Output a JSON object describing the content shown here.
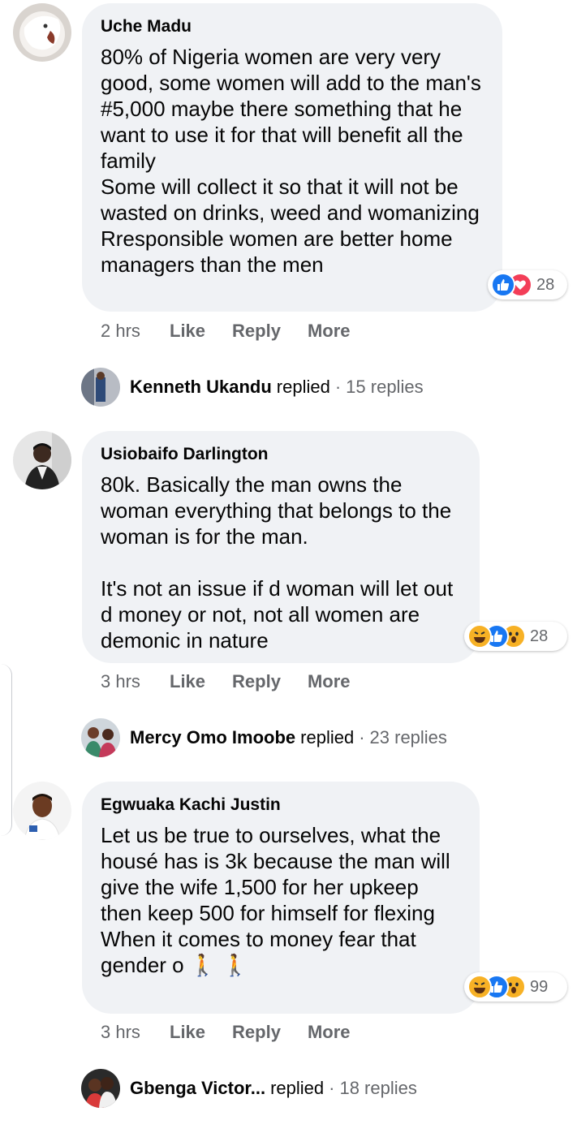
{
  "comments": [
    {
      "author": "Uche Madu",
      "text": "80% of Nigeria women are very very good, some women will add to the man's #5,000 maybe there something that he want to use it for that will benefit all the family\nSome will collect it so that it will not be wasted on drinks, weed and womanizing\nRresponsible women are better home managers than the men",
      "reaction_count": "28",
      "time": "2 hrs",
      "like": "Like",
      "reply": "Reply",
      "more": "More",
      "replier": "Kenneth Ukandu",
      "replied": "replied",
      "replies": "15 replies"
    },
    {
      "author": "Usiobaifo Darlington",
      "text": "80k. Basically the man owns the woman everything that belongs to the woman is for the man.\n\nIt's not an issue if d woman will let out d money or not, not all women are demonic in nature",
      "reaction_count": "28",
      "time": "3 hrs",
      "like": "Like",
      "reply": "Reply",
      "more": "More",
      "replier": "Mercy Omo Imoobe",
      "replied": "replied",
      "replies": "23 replies"
    },
    {
      "author": "Egwuaka Kachi Justin",
      "text": "Let us be true to ourselves, what the housé has is 3k because the man will give the wife 1,500 for her upkeep then keep 500 for himself for flexing\nWhen it comes to money fear that gender o 🚶 🚶",
      "reaction_count": "99",
      "time": "3 hrs",
      "like": "Like",
      "reply": "Reply",
      "more": "More",
      "replier": "Gbenga Victor...",
      "replied": "replied",
      "replies": "18 replies"
    }
  ],
  "reaction_icons": {
    "c0": [
      "like-icon",
      "love-icon"
    ],
    "c1": [
      "haha-icon",
      "like-icon",
      "wow-icon"
    ],
    "c2": [
      "haha-icon",
      "like-icon",
      "wow-icon"
    ]
  },
  "separator": "·",
  "colors": {
    "bubble": "#f0f2f5",
    "like_blue": "#1877f2",
    "love_red": "#f33e58",
    "emoji_yellow": "#f7b125",
    "meta_gray": "#65676b"
  }
}
